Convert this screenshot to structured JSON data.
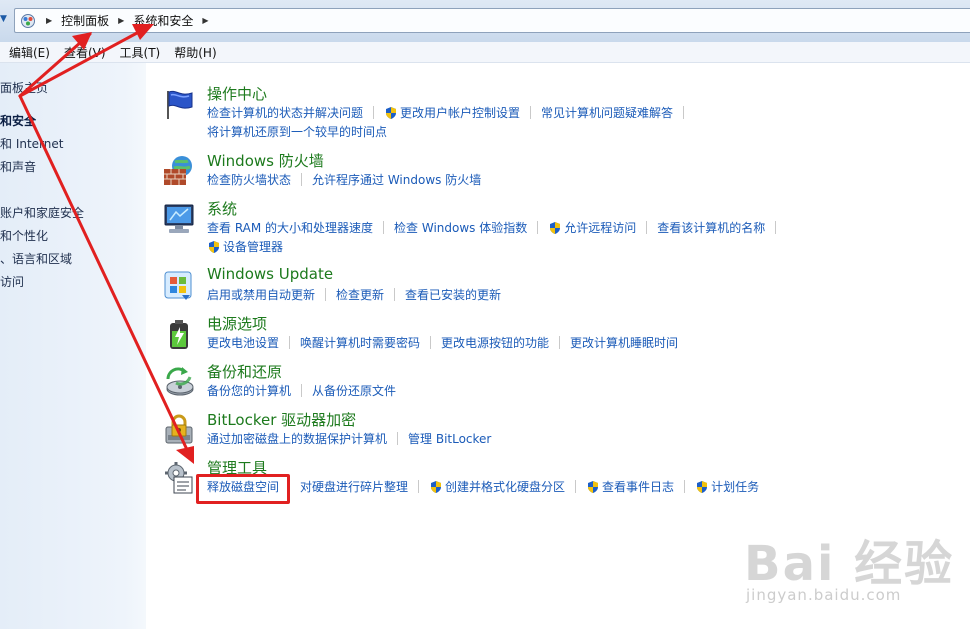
{
  "address_bar": {
    "breadcrumbs": [
      "控制面板",
      "系统和安全"
    ],
    "icon": "control-panel-icon"
  },
  "menu": {
    "items": [
      "编辑(E)",
      "查看(V)",
      "工具(T)",
      "帮助(H)"
    ]
  },
  "left_pane": {
    "items": [
      {
        "label": "面板主页",
        "bold": false
      },
      {
        "label": "和安全",
        "bold": true
      },
      {
        "label": "和 Internet",
        "bold": false
      },
      {
        "label": "和声音",
        "bold": false
      },
      {
        "label": "账户和家庭安全",
        "bold": false
      },
      {
        "label": "和个性化",
        "bold": false
      },
      {
        "label": "、语言和区域",
        "bold": false
      },
      {
        "label": "访问",
        "bold": false
      }
    ]
  },
  "sections": [
    {
      "icon": "flag-icon",
      "title": "操作中心",
      "rows": [
        [
          {
            "label": "检查计算机的状态并解决问题",
            "shield": false
          },
          {
            "label": "更改用户帐户控制设置",
            "shield": true
          },
          {
            "label": "常见计算机问题疑难解答",
            "shield": false
          }
        ],
        [
          {
            "label": "将计算机还原到一个较早的时间点",
            "shield": false
          }
        ]
      ]
    },
    {
      "icon": "firewall-icon",
      "title": "Windows 防火墙",
      "rows": [
        [
          {
            "label": "检查防火墙状态",
            "shield": false
          },
          {
            "label": "允许程序通过 Windows 防火墙",
            "shield": false
          }
        ]
      ]
    },
    {
      "icon": "computer-icon",
      "title": "系统",
      "rows": [
        [
          {
            "label": "查看 RAM 的大小和处理器速度",
            "shield": false
          },
          {
            "label": "检查 Windows 体验指数",
            "shield": false
          },
          {
            "label": "允许远程访问",
            "shield": true
          },
          {
            "label": "查看该计算机的名称",
            "shield": false
          }
        ],
        [
          {
            "label": "设备管理器",
            "shield": true
          }
        ]
      ]
    },
    {
      "icon": "windows-update-icon",
      "title": "Windows Update",
      "rows": [
        [
          {
            "label": "启用或禁用自动更新",
            "shield": false
          },
          {
            "label": "检查更新",
            "shield": false
          },
          {
            "label": "查看已安装的更新",
            "shield": false
          }
        ]
      ]
    },
    {
      "icon": "battery-icon",
      "title": "电源选项",
      "rows": [
        [
          {
            "label": "更改电池设置",
            "shield": false
          },
          {
            "label": "唤醒计算机时需要密码",
            "shield": false
          },
          {
            "label": "更改电源按钮的功能",
            "shield": false
          },
          {
            "label": "更改计算机睡眠时间",
            "shield": false
          }
        ]
      ]
    },
    {
      "icon": "backup-icon",
      "title": "备份和还原",
      "rows": [
        [
          {
            "label": "备份您的计算机",
            "shield": false
          },
          {
            "label": "从备份还原文件",
            "shield": false
          }
        ]
      ]
    },
    {
      "icon": "bitlocker-icon",
      "title": "BitLocker 驱动器加密",
      "rows": [
        [
          {
            "label": "通过加密磁盘上的数据保护计算机",
            "shield": false
          },
          {
            "label": "管理 BitLocker",
            "shield": false
          }
        ]
      ]
    },
    {
      "icon": "admin-tools-icon",
      "title": "管理工具",
      "rows": [
        [
          {
            "label": "释放磁盘空间",
            "shield": false
          },
          {
            "label": "对硬盘进行碎片整理",
            "shield": false
          },
          {
            "label": "创建并格式化硬盘分区",
            "shield": true
          },
          {
            "label": "查看事件日志",
            "shield": true
          },
          {
            "label": "计划任务",
            "shield": true
          }
        ]
      ]
    }
  ],
  "watermark": {
    "brand": "Bai 经验",
    "url": "jingyan.baidu.com"
  },
  "colors": {
    "title_green": "#1d7a1d",
    "link_blue": "#1b5bb8",
    "annotation_red": "#e12020"
  }
}
